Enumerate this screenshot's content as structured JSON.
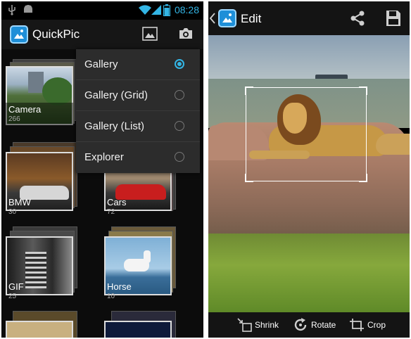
{
  "left_screen": {
    "status_bar": {
      "time": "08:28"
    },
    "action_bar": {
      "app_title": "QuickPic"
    },
    "albums": [
      {
        "name": "Camera",
        "count": "266"
      },
      {
        "name": "BMW",
        "count": "30"
      },
      {
        "name": "Cars",
        "count": "72"
      },
      {
        "name": "GIF",
        "count": "25"
      },
      {
        "name": "Horse",
        "count": "10"
      }
    ],
    "view_menu": {
      "items": [
        {
          "label": "Gallery",
          "selected": true
        },
        {
          "label": "Gallery (Grid)",
          "selected": false
        },
        {
          "label": "Gallery (List)",
          "selected": false
        },
        {
          "label": "Explorer",
          "selected": false
        }
      ]
    }
  },
  "right_screen": {
    "action_bar": {
      "title": "Edit"
    },
    "bottom_bar": {
      "shrink_label": "Shrink",
      "rotate_label": "Rotate",
      "crop_label": "Crop"
    }
  },
  "colors": {
    "accent": "#33b5e5",
    "bar_background": "#161616"
  }
}
